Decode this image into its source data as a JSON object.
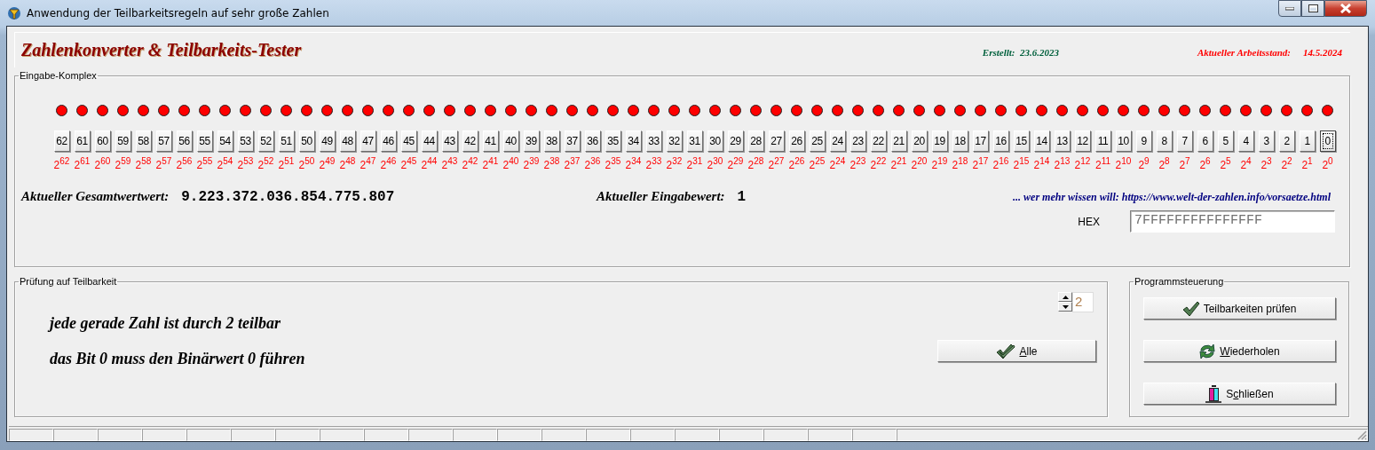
{
  "window": {
    "title": "Anwendung der Teilbarkeitsregeln auf sehr große Zahlen"
  },
  "header": {
    "title": "Zahlenkonverter & Teilbarkeits-Tester",
    "created": "Erstellt:  23.6.2023",
    "status_label": "Aktueller Arbeitsstand:",
    "status_date": "14.5.2024"
  },
  "input_group": {
    "title": "Eingabe-Komplex",
    "bits": [
      {
        "label": "62",
        "power": "2$^{62}$",
        "on": true,
        "focused": false
      },
      {
        "label": "61",
        "power": "2$^{61}$",
        "on": true,
        "focused": false
      },
      {
        "label": "60",
        "power": "2$^{60}$",
        "on": true,
        "focused": false
      },
      {
        "label": "59",
        "power": "2$^{59}$",
        "on": true,
        "focused": false
      },
      {
        "label": "58",
        "power": "2$^{58}$",
        "on": true,
        "focused": false
      },
      {
        "label": "57",
        "power": "2$^{57}$",
        "on": true,
        "focused": false
      },
      {
        "label": "56",
        "power": "2$^{56}$",
        "on": true,
        "focused": false
      },
      {
        "label": "55",
        "power": "2$^{55}$",
        "on": true,
        "focused": false
      },
      {
        "label": "54",
        "power": "2$^{54}$",
        "on": true,
        "focused": false
      },
      {
        "label": "53",
        "power": "2$^{53}$",
        "on": true,
        "focused": false
      },
      {
        "label": "52",
        "power": "2$^{52}$",
        "on": true,
        "focused": false
      },
      {
        "label": "51",
        "power": "2$^{51}$",
        "on": true,
        "focused": false
      },
      {
        "label": "50",
        "power": "2$^{50}$",
        "on": true,
        "focused": false
      },
      {
        "label": "49",
        "power": "2$^{49}$",
        "on": true,
        "focused": false
      },
      {
        "label": "48",
        "power": "2$^{48}$",
        "on": true,
        "focused": false
      },
      {
        "label": "47",
        "power": "2$^{47}$",
        "on": true,
        "focused": false
      },
      {
        "label": "46",
        "power": "2$^{46}$",
        "on": true,
        "focused": false
      },
      {
        "label": "45",
        "power": "2$^{45}$",
        "on": true,
        "focused": false
      },
      {
        "label": "44",
        "power": "2$^{44}$",
        "on": true,
        "focused": false
      },
      {
        "label": "43",
        "power": "2$^{43}$",
        "on": true,
        "focused": false
      },
      {
        "label": "42",
        "power": "2$^{42}$",
        "on": true,
        "focused": false
      },
      {
        "label": "41",
        "power": "2$^{41}$",
        "on": true,
        "focused": false
      },
      {
        "label": "40",
        "power": "2$^{40}$",
        "on": true,
        "focused": false
      },
      {
        "label": "39",
        "power": "2$^{39}$",
        "on": true,
        "focused": false
      },
      {
        "label": "38",
        "power": "2$^{38}$",
        "on": true,
        "focused": false
      },
      {
        "label": "37",
        "power": "2$^{37}$",
        "on": true,
        "focused": false
      },
      {
        "label": "36",
        "power": "2$^{36}$",
        "on": true,
        "focused": false
      },
      {
        "label": "35",
        "power": "2$^{35}$",
        "on": true,
        "focused": false
      },
      {
        "label": "34",
        "power": "2$^{34}$",
        "on": true,
        "focused": false
      },
      {
        "label": "33",
        "power": "2$^{33}$",
        "on": true,
        "focused": false
      },
      {
        "label": "32",
        "power": "2$^{32}$",
        "on": true,
        "focused": false
      },
      {
        "label": "31",
        "power": "2$^{31}$",
        "on": true,
        "focused": false
      },
      {
        "label": "30",
        "power": "2$^{30}$",
        "on": true,
        "focused": false
      },
      {
        "label": "29",
        "power": "2$^{29}$",
        "on": true,
        "focused": false
      },
      {
        "label": "28",
        "power": "2$^{28}$",
        "on": true,
        "focused": false
      },
      {
        "label": "27",
        "power": "2$^{27}$",
        "on": true,
        "focused": false
      },
      {
        "label": "26",
        "power": "2$^{26}$",
        "on": true,
        "focused": false
      },
      {
        "label": "25",
        "power": "2$^{25}$",
        "on": true,
        "focused": false
      },
      {
        "label": "24",
        "power": "2$^{24}$",
        "on": true,
        "focused": false
      },
      {
        "label": "23",
        "power": "2$^{23}$",
        "on": true,
        "focused": false
      },
      {
        "label": "22",
        "power": "2$^{22}$",
        "on": true,
        "focused": false
      },
      {
        "label": "21",
        "power": "2$^{21}$",
        "on": true,
        "focused": false
      },
      {
        "label": "20",
        "power": "2$^{20}$",
        "on": true,
        "focused": false
      },
      {
        "label": "19",
        "power": "2$^{19}$",
        "on": true,
        "focused": false
      },
      {
        "label": "18",
        "power": "2$^{18}$",
        "on": true,
        "focused": false
      },
      {
        "label": "17",
        "power": "2$^{17}$",
        "on": true,
        "focused": false
      },
      {
        "label": "16",
        "power": "2$^{16}$",
        "on": true,
        "focused": false
      },
      {
        "label": "15",
        "power": "2$^{15}$",
        "on": true,
        "focused": false
      },
      {
        "label": "14",
        "power": "2$^{14}$",
        "on": true,
        "focused": false
      },
      {
        "label": "13",
        "power": "2$^{13}$",
        "on": true,
        "focused": false
      },
      {
        "label": "12",
        "power": "2$^{12}$",
        "on": true,
        "focused": false
      },
      {
        "label": "11",
        "power": "2$^{11}$",
        "on": true,
        "focused": false
      },
      {
        "label": "10",
        "power": "2$^{10}$",
        "on": true,
        "focused": false
      },
      {
        "label": "9",
        "power": "2$^{9}$",
        "on": true,
        "focused": false
      },
      {
        "label": "8",
        "power": "2$^{8}$",
        "on": true,
        "focused": false
      },
      {
        "label": "7",
        "power": "2$^{7}$",
        "on": true,
        "focused": false
      },
      {
        "label": "6",
        "power": "2$^{6}$",
        "on": true,
        "focused": false
      },
      {
        "label": "5",
        "power": "2$^{5}$",
        "on": true,
        "focused": false
      },
      {
        "label": "4",
        "power": "2$^{4}$",
        "on": true,
        "focused": false
      },
      {
        "label": "3",
        "power": "2$^{3}$",
        "on": true,
        "focused": false
      },
      {
        "label": "2",
        "power": "2$^{2}$",
        "on": true,
        "focused": false
      },
      {
        "label": "1",
        "power": "2$^{1}$",
        "on": true,
        "focused": false
      },
      {
        "label": "0",
        "power": "2$^{0}$",
        "on": true,
        "focused": true
      }
    ],
    "total_label": "Aktueller Gesamtwertwert:",
    "total_value": "9.223.372.036.854.775.807",
    "input_label": "Aktueller Eingabewert:",
    "input_value": "1",
    "link": "... wer mehr wissen will: https://www.welt-der-zahlen.info/vorsaetze.html",
    "hex_label": "HEX",
    "hex_value": "7FFFFFFFFFFFFFFF"
  },
  "check_group": {
    "title": "Prüfung auf Teilbarkeit",
    "rules": [
      "jede gerade Zahl ist durch 2 teilbar",
      "das Bit 0 muss den Binärwert 0 führen"
    ],
    "divisor": "2",
    "all_button": {
      "label_parts": [
        {
          "text": "A",
          "underline": true
        },
        {
          "text": "lle",
          "underline": false
        }
      ]
    }
  },
  "control_group": {
    "title": "Programmsteuerung",
    "buttons": [
      {
        "kind": "check",
        "label_parts": [
          {
            "text": "Teilbarkeiten prüfen",
            "underline": false
          }
        ]
      },
      {
        "kind": "refresh",
        "label_parts": [
          {
            "text": "W",
            "underline": true
          },
          {
            "text": "iederholen",
            "underline": false
          }
        ]
      },
      {
        "kind": "exit",
        "label_parts": [
          {
            "text": "S",
            "underline": false
          },
          {
            "text": "c",
            "underline": true
          },
          {
            "text": "hließen",
            "underline": false
          }
        ]
      }
    ]
  }
}
